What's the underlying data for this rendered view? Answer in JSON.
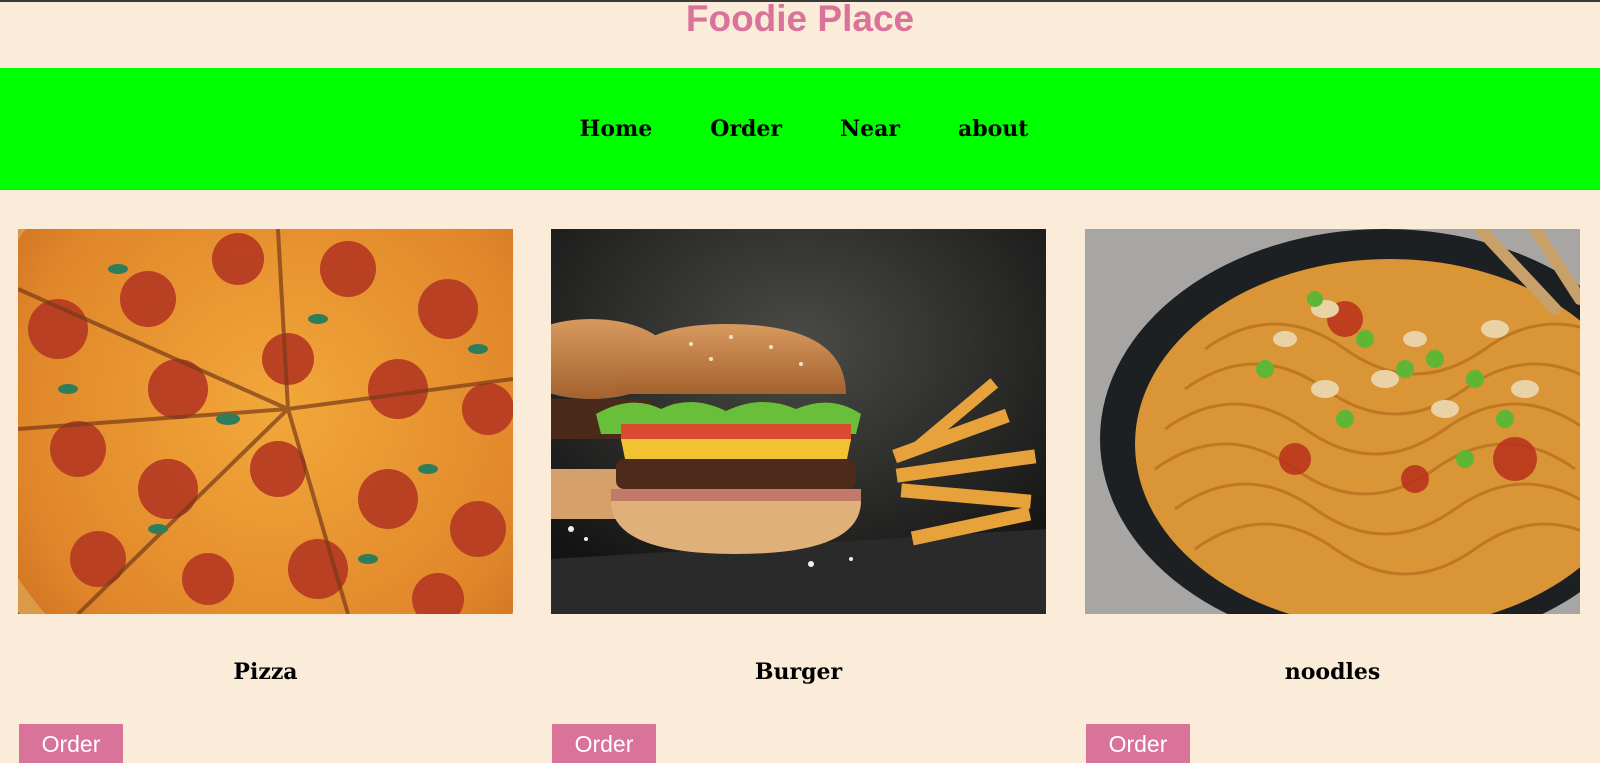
{
  "site": {
    "title": "Foodie Place",
    "colors": {
      "background": "#fbebd9",
      "navbar": "#00ff00",
      "accent": "#d9739a"
    }
  },
  "nav": {
    "items": [
      {
        "label": "Home"
      },
      {
        "label": "Order"
      },
      {
        "label": "Near"
      },
      {
        "label": "about"
      }
    ]
  },
  "menu": {
    "items": [
      {
        "name": "Pizza",
        "image": "pizza-photo",
        "button_label": "Order"
      },
      {
        "name": "Burger",
        "image": "burger-photo",
        "button_label": "Order"
      },
      {
        "name": "noodles",
        "image": "noodles-photo",
        "button_label": "Order"
      }
    ]
  }
}
